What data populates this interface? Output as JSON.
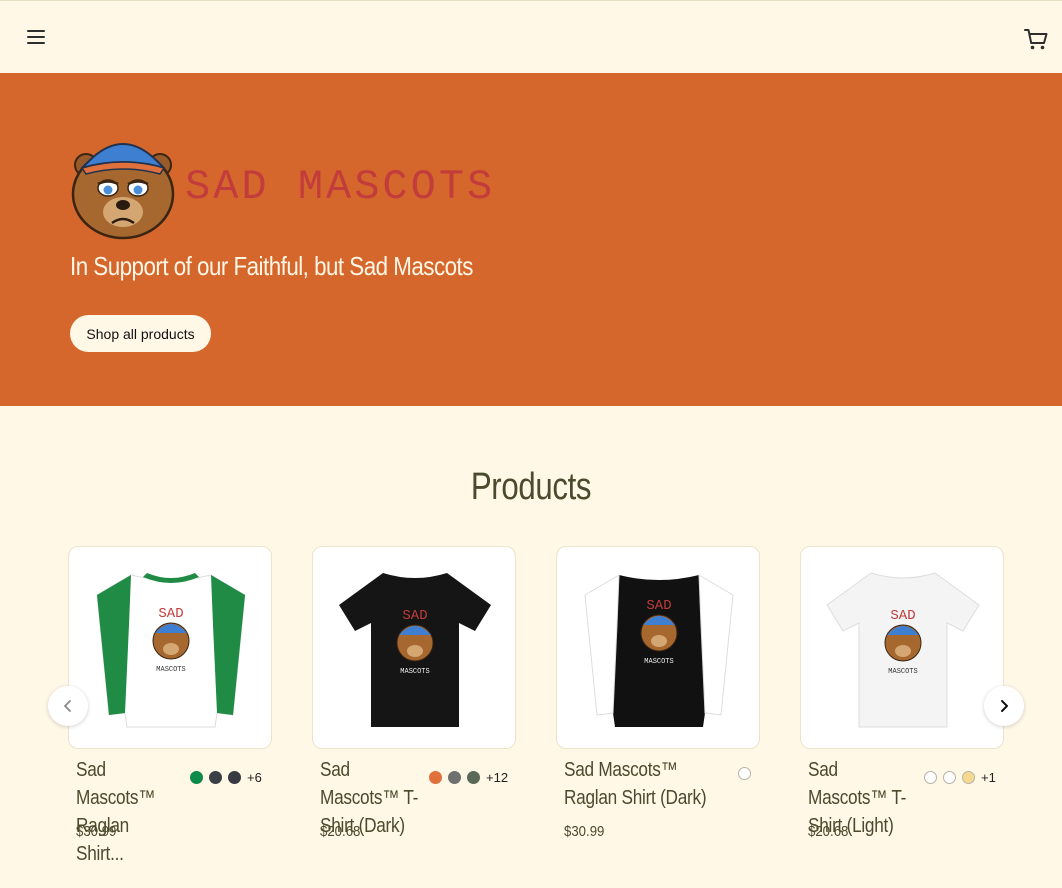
{
  "header": {
    "menu_icon": "hamburger-icon",
    "cart_icon": "cart-icon"
  },
  "hero": {
    "logo_text": "SAD MASCOTS",
    "tagline": "In Support of our Faithful, but Sad Mascots",
    "cta_label": "Shop all products",
    "background_color": "#d6672c"
  },
  "products": {
    "title": "Products",
    "items": [
      {
        "name": "Sad Mascots™ Raglan Shirt...",
        "price": "$30.99",
        "swatches": [
          "#0e8a4a",
          "#3a3f45",
          "#373a40"
        ],
        "more": "+6",
        "shirt_style": "raglan-green"
      },
      {
        "name": "Sad Mascots™ T-Shirt (Dark)",
        "price": "$20.68",
        "swatches": [
          "#e0703c",
          "#6e716f",
          "#5b6a58"
        ],
        "more": "+12",
        "shirt_style": "tee-black"
      },
      {
        "name": "Sad Mascots™ Raglan Shirt (Dark)",
        "price": "$30.99",
        "swatches": [
          "#ffffff"
        ],
        "more": "",
        "shirt_style": "raglan-black"
      },
      {
        "name": "Sad Mascots™ T-Shirt (Light)",
        "price": "$20.68",
        "swatches": [
          "#ffffff",
          "#ffffff",
          "#f6d98e"
        ],
        "more": "+1",
        "shirt_style": "tee-white"
      }
    ],
    "prev_icon": "chevron-left-icon",
    "next_icon": "chevron-right-icon"
  }
}
